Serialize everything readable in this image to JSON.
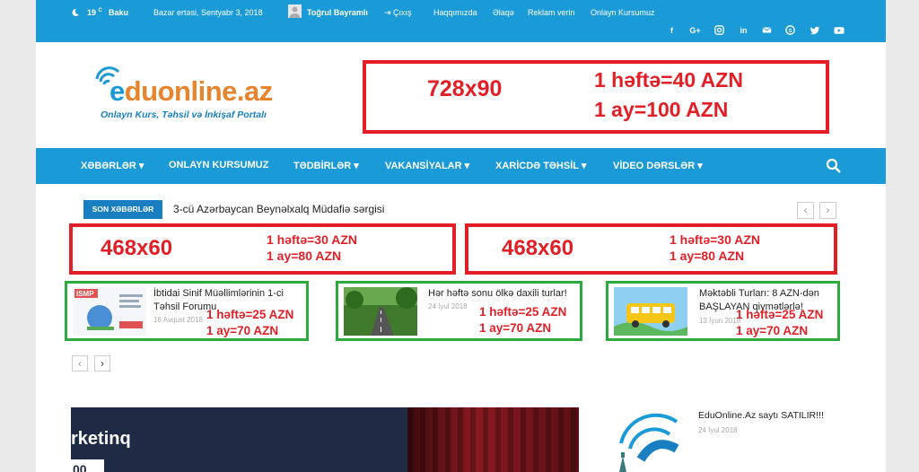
{
  "topbar": {
    "temperature": "19",
    "temp_unit": "C",
    "city": "Baku",
    "date": "Bazar ertəsi, Sentyabr 3, 2018",
    "user": "Toğrul Bayramlı",
    "logout": "Çıxış",
    "links": [
      "Haqqımızda",
      "Əlaqə",
      "Reklam verin",
      "Onlayn Kursumuz"
    ],
    "social_icons": [
      "facebook-icon",
      "google-plus-icon",
      "instagram-icon",
      "linkedin-icon",
      "mail-icon",
      "skype-icon",
      "twitter-icon",
      "youtube-icon"
    ]
  },
  "logo": {
    "name_prefix": "e",
    "name_rest": "duonline.az",
    "tagline": "Onlayn Kurs, Təhsil və İnkişaf Portalı"
  },
  "ad_top": {
    "size": "728x90",
    "week": "1 həftə=40 AZN",
    "month": "1 ay=100 AZN"
  },
  "nav": {
    "items": [
      "XƏBƏRLƏR",
      "ONLAYN KURSUMUZ",
      "TƏDBİRLƏR",
      "VAKANSİYALAR",
      "XARİCDƏ TƏHSİL",
      "VİDEO DƏRSLƏR"
    ],
    "search_icon": "search-icon"
  },
  "ticker": {
    "label": "SON XƏBƏRLƏR",
    "text": "3-cü Azərbaycan Beynəlxalq Müdafiə sərgisi",
    "prev": "‹",
    "next": "›"
  },
  "ads_mid": [
    {
      "size": "468x60",
      "week": "1 həftə=30 AZN",
      "month": "1 ay=80 AZN"
    },
    {
      "size": "468x60",
      "week": "1 həftə=30 AZN",
      "month": "1 ay=80 AZN"
    }
  ],
  "posts": [
    {
      "title": "İbtidai Sinif Müəllimlərinin 1-ci Təhsil Forumu",
      "date": "16 Avqust 2018",
      "week": "1 həftə=25 AZN",
      "month": "1 ay=70 AZN"
    },
    {
      "title": "Hər həftə sonu ölkə daxili turlar!",
      "date": "24 İyul 2018",
      "week": "1 həftə=25 AZN",
      "month": "1 ay=70 AZN"
    },
    {
      "title": "Məktəbli Turları: 8 AZN-dən BAŞLAYAN qiymətlərlə!",
      "date": "13 İyun 2018",
      "week": "1 həftə=25 AZN",
      "month": "1 ay=70 AZN"
    }
  ],
  "pager": {
    "prev": "‹",
    "next": "›"
  },
  "bottom": {
    "main_title": "rketinq",
    "main_number": "00",
    "side_title": "EduOnline.Az saytı SATILIR!!!",
    "side_date": "24 İyul 2018"
  },
  "colors": {
    "brand_blue": "#1a9ad6",
    "ad_red": "#e21f26",
    "ad_green": "#2daa3e",
    "logo_orange": "#e8842c"
  }
}
